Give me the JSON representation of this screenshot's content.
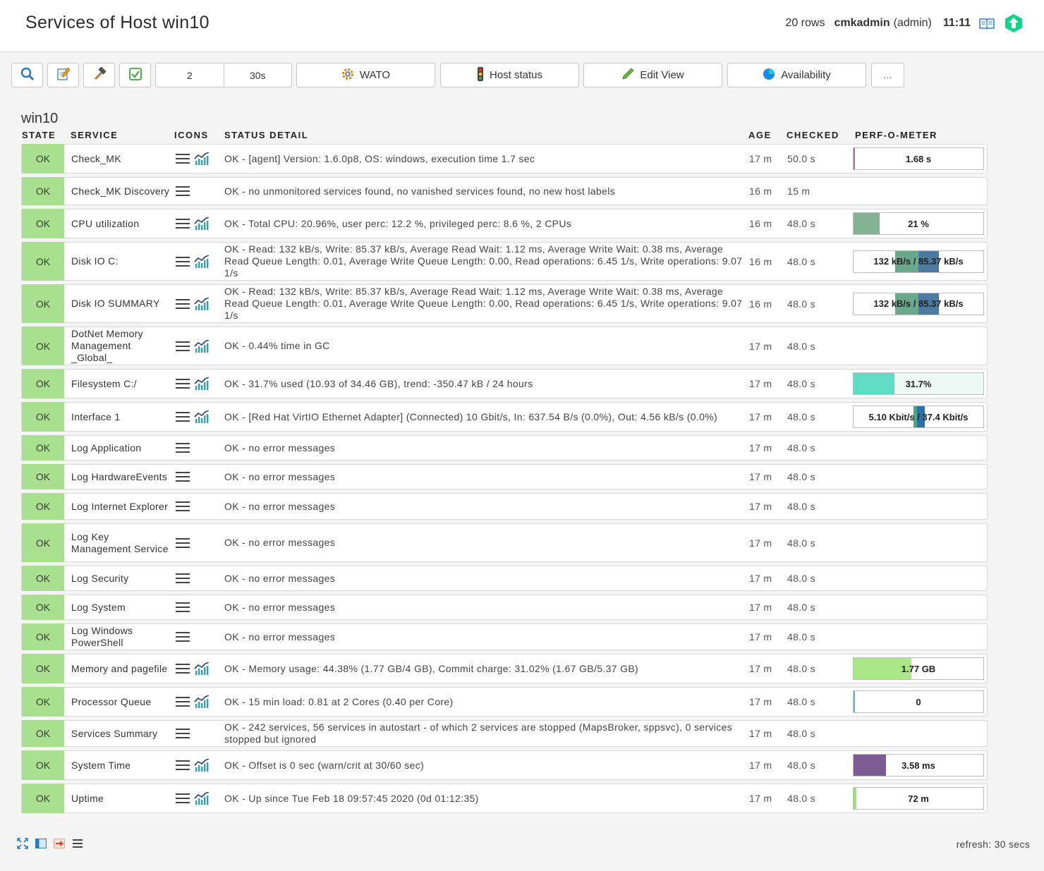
{
  "header": {
    "title": "Services of Host win10",
    "rows_count": "20 rows",
    "user": "cmkadmin",
    "role": "(admin)",
    "time": "11:11"
  },
  "toolbar": {
    "refresh_count": "2",
    "refresh_interval": "30s",
    "wato_label": "WATO",
    "host_status_label": "Host status",
    "edit_view_label": "Edit View",
    "availability_label": "Availability",
    "more_label": "..."
  },
  "host": {
    "name": "win10"
  },
  "columns": {
    "state": "STATE",
    "service": "SERVICE",
    "icons": "ICONS",
    "status_detail": "STATUS DETAIL",
    "age": "AGE",
    "checked": "CHECKED",
    "perf": "PERF-O-METER"
  },
  "services": [
    {
      "state": "OK",
      "name": "Check_MK",
      "graph": true,
      "detail": "OK - [agent] Version: 1.6.0p8, OS: windows, execution time 1.7 sec",
      "age": "17 m",
      "checked": "50.0 s",
      "perf": {
        "label": "1.68 s",
        "bars": [
          {
            "start": 0,
            "width": 0.01,
            "color": "#9a76a8"
          }
        ]
      }
    },
    {
      "state": "OK",
      "name": "Check_MK Discovery",
      "graph": false,
      "detail": "OK - no unmonitored services found, no vanished services found, no new host labels",
      "age": "16 m",
      "checked": "15 m",
      "perf": null
    },
    {
      "state": "OK",
      "name": "CPU utilization",
      "graph": true,
      "detail": "OK - Total CPU: 20.96%, user perc: 12.2 %, privileged perc: 8.6 %, 2 CPUs",
      "age": "16 m",
      "checked": "48.0 s",
      "perf": {
        "label": "21 %",
        "bars": [
          {
            "start": 0,
            "width": 0.2,
            "color": "#86b294"
          }
        ]
      }
    },
    {
      "state": "OK",
      "name": "Disk IO C:",
      "graph": true,
      "detail": "OK - Read: 132 kB/s, Write: 85.37 kB/s, Average Read Wait: 1.12 ms, Average Write Wait: 0.38 ms, Average Read Queue Length: 0.01, Average Write Queue Length: 0.00, Read operations: 6.45 1/s, Write operations: 9.07 1/s",
      "age": "16 m",
      "checked": "48.0 s",
      "perf": {
        "label": "132 kB/s / 85.37 kB/s",
        "bars": [
          {
            "start": 0.32,
            "width": 0.18,
            "color": "#6aa88c"
          },
          {
            "start": 0.5,
            "width": 0.16,
            "color": "#4d7aa0"
          }
        ]
      }
    },
    {
      "state": "OK",
      "name": "Disk IO SUMMARY",
      "graph": true,
      "detail": "OK - Read: 132 kB/s, Write: 85.37 kB/s, Average Read Wait: 1.12 ms, Average Write Wait: 0.38 ms, Average Read Queue Length: 0.01, Average Write Queue Length: 0.00, Read operations: 6.45 1/s, Write operations: 9.07 1/s",
      "age": "16 m",
      "checked": "48.0 s",
      "perf": {
        "label": "132 kB/s / 85.37 kB/s",
        "bars": [
          {
            "start": 0.32,
            "width": 0.18,
            "color": "#6aa88c"
          },
          {
            "start": 0.5,
            "width": 0.16,
            "color": "#4d7aa0"
          }
        ]
      }
    },
    {
      "state": "OK",
      "name": "DotNet Memory Management _Global_",
      "graph": true,
      "detail": "OK - 0.44% time in GC",
      "age": "17 m",
      "checked": "48.0 s",
      "perf": null
    },
    {
      "state": "OK",
      "name": "Filesystem C:/",
      "graph": true,
      "detail": "OK - 31.7% used (10.93 of 34.46 GB), trend: -350.47 kB / 24 hours",
      "age": "17 m",
      "checked": "48.0 s",
      "perf": {
        "label": "31.7%",
        "bg": "#ecf8f4",
        "bars": [
          {
            "start": 0,
            "width": 0.317,
            "color": "#5fdcc4"
          }
        ]
      }
    },
    {
      "state": "OK",
      "name": "Interface 1",
      "graph": true,
      "detail": "OK - [Red Hat VirtIO Ethernet Adapter] (Connected) 10 Gbit/s, In: 637.54 B/s (0.0%), Out: 4.56 kB/s (0.0%)",
      "age": "17 m",
      "checked": "48.0 s",
      "perf": {
        "label": "5.10 Kbit/s / 37.4 Kbit/s",
        "bars": [
          {
            "start": 0.46,
            "width": 0.03,
            "color": "#3fae74"
          },
          {
            "start": 0.49,
            "width": 0.06,
            "color": "#2f6fa8"
          }
        ]
      }
    },
    {
      "state": "OK",
      "name": "Log Application",
      "graph": false,
      "detail": "OK - no error messages",
      "age": "17 m",
      "checked": "48.0 s",
      "perf": null
    },
    {
      "state": "OK",
      "name": "Log HardwareEvents",
      "graph": false,
      "detail": "OK - no error messages",
      "age": "17 m",
      "checked": "48.0 s",
      "perf": null
    },
    {
      "state": "OK",
      "name": "Log Internet Explorer",
      "graph": false,
      "detail": "OK - no error messages",
      "age": "17 m",
      "checked": "48.0 s",
      "perf": null
    },
    {
      "state": "OK",
      "name": "Log Key Management Service",
      "graph": false,
      "detail": "OK - no error messages",
      "age": "17 m",
      "checked": "48.0 s",
      "perf": null
    },
    {
      "state": "OK",
      "name": "Log Security",
      "graph": false,
      "detail": "OK - no error messages",
      "age": "17 m",
      "checked": "48.0 s",
      "perf": null
    },
    {
      "state": "OK",
      "name": "Log System",
      "graph": false,
      "detail": "OK - no error messages",
      "age": "17 m",
      "checked": "48.0 s",
      "perf": null
    },
    {
      "state": "OK",
      "name": "Log Windows PowerShell",
      "graph": false,
      "detail": "OK - no error messages",
      "age": "17 m",
      "checked": "48.0 s",
      "perf": null
    },
    {
      "state": "OK",
      "name": "Memory and pagefile",
      "graph": true,
      "detail": "OK - Memory usage: 44.38% (1.77 GB/4 GB), Commit charge: 31.02% (1.67 GB/5.37 GB)",
      "age": "17 m",
      "checked": "48.0 s",
      "perf": {
        "label": "1.77 GB",
        "bars": [
          {
            "start": 0,
            "width": 0.444,
            "color": "#a9e884"
          }
        ]
      }
    },
    {
      "state": "OK",
      "name": "Processor Queue",
      "graph": true,
      "detail": "OK - 15 min load: 0.81 at 2 Cores (0.40 per Core)",
      "age": "17 m",
      "checked": "48.0 s",
      "perf": {
        "label": "0",
        "bars": [
          {
            "start": 0,
            "width": 0.01,
            "color": "#63b7d0"
          }
        ]
      }
    },
    {
      "state": "OK",
      "name": "Services Summary",
      "graph": false,
      "detail": "OK - 242 services, 56 services in autostart - of which 2 services are stopped (MapsBroker, sppsvc), 0 services stopped but ignored",
      "age": "17 m",
      "checked": "48.0 s",
      "perf": null
    },
    {
      "state": "OK",
      "name": "System Time",
      "graph": true,
      "detail": "OK - Offset is 0 sec (warn/crit at 30/60 sec)",
      "age": "17 m",
      "checked": "48.0 s",
      "perf": {
        "label": "3.58 ms",
        "bars": [
          {
            "start": 0,
            "width": 0.25,
            "color": "#7f5b94"
          }
        ]
      }
    },
    {
      "state": "OK",
      "name": "Uptime",
      "graph": true,
      "detail": "OK - Up since Tue Feb 18 09:57:45 2020 (0d 01:12:35)",
      "age": "17 m",
      "checked": "48.0 s",
      "perf": {
        "label": "72 m",
        "bars": [
          {
            "start": 0,
            "width": 0.02,
            "color": "#9ee07a"
          }
        ]
      }
    }
  ],
  "footer": {
    "refresh": "refresh: 30 secs"
  },
  "colors": {
    "ok_state": "#a8e08f",
    "accent_green": "#13d389",
    "graph_teal": "#22a6b8"
  }
}
